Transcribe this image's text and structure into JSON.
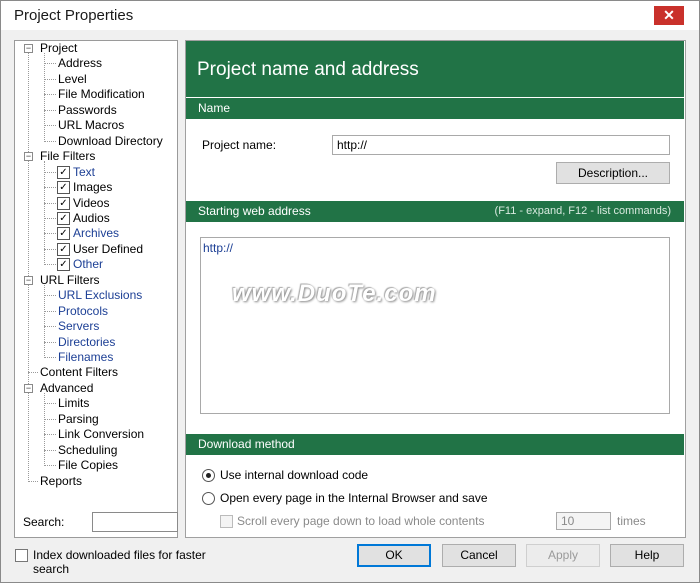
{
  "window": {
    "title": "Project Properties",
    "close_glyph": "✕"
  },
  "tree": {
    "items": [
      {
        "label": "Project",
        "level": 0,
        "expander": "−"
      },
      {
        "label": "Address",
        "level": 1
      },
      {
        "label": "Level",
        "level": 1
      },
      {
        "label": "File Modification",
        "level": 1
      },
      {
        "label": "Passwords",
        "level": 1
      },
      {
        "label": "URL Macros",
        "level": 1
      },
      {
        "label": "Download Directory",
        "level": 1
      },
      {
        "label": "File Filters",
        "level": 0,
        "expander": "−"
      },
      {
        "label": "Text",
        "level": 1,
        "checked": true,
        "blue": true
      },
      {
        "label": "Images",
        "level": 1,
        "checked": true
      },
      {
        "label": "Videos",
        "level": 1,
        "checked": true
      },
      {
        "label": "Audios",
        "level": 1,
        "checked": true
      },
      {
        "label": "Archives",
        "level": 1,
        "checked": true,
        "blue": true
      },
      {
        "label": "User Defined",
        "level": 1,
        "checked": true
      },
      {
        "label": "Other",
        "level": 1,
        "checked": true,
        "blue": true
      },
      {
        "label": "URL Filters",
        "level": 0,
        "expander": "−"
      },
      {
        "label": "URL Exclusions",
        "level": 1,
        "blue": true
      },
      {
        "label": "Protocols",
        "level": 1,
        "blue": true
      },
      {
        "label": "Servers",
        "level": 1,
        "blue": true
      },
      {
        "label": "Directories",
        "level": 1,
        "blue": true
      },
      {
        "label": "Filenames",
        "level": 1,
        "blue": true
      },
      {
        "label": "Content Filters",
        "level": 0
      },
      {
        "label": "Advanced",
        "level": 0,
        "expander": "−"
      },
      {
        "label": "Limits",
        "level": 1
      },
      {
        "label": "Parsing",
        "level": 1
      },
      {
        "label": "Link Conversion",
        "level": 1
      },
      {
        "label": "Scheduling",
        "level": 1
      },
      {
        "label": "File Copies",
        "level": 1
      },
      {
        "label": "Reports",
        "level": 0
      }
    ],
    "search_label": "Search:",
    "search_value": ""
  },
  "main": {
    "header": "Project name and address",
    "name_section": "Name",
    "project_name_label": "Project name:",
    "project_name_value": "http://",
    "description_button": "Description...",
    "start_section": "Starting web address",
    "start_hint": "(F11 - expand, F12 - list commands)",
    "start_value": "http://",
    "watermark": "www.DuoTe.com",
    "download_section": "Download method",
    "radio_internal": "Use internal download code",
    "radio_browser": "Open every page in the Internal Browser and save",
    "scroll_label": "Scroll every page down to load whole contents",
    "times_value": "10",
    "times_label": "times"
  },
  "footer": {
    "index_label": "Index downloaded files for faster search",
    "ok": "OK",
    "cancel": "Cancel",
    "apply": "Apply",
    "help": "Help"
  },
  "colors": {
    "accent": "#217346",
    "close": "#c9312b",
    "link": "#1c3f95"
  }
}
